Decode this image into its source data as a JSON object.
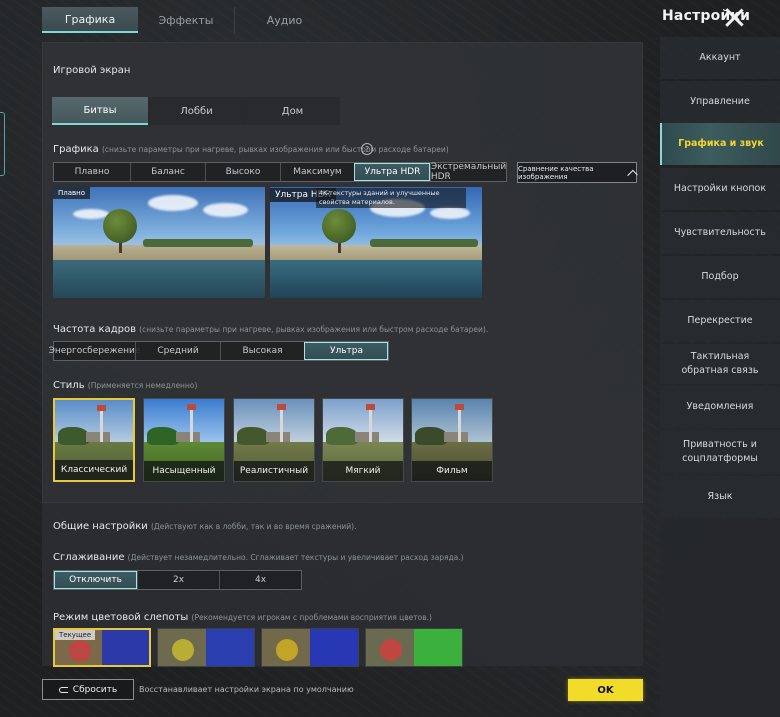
{
  "header": {
    "title": "Настройки",
    "tabs": [
      {
        "label": "Графика",
        "active": true
      },
      {
        "label": "Эффекты",
        "active": false
      },
      {
        "label": "Аудио",
        "active": false
      }
    ]
  },
  "screen": {
    "section_title": "Игровой экран",
    "mode_tabs": [
      {
        "label": "Битвы",
        "active": true
      },
      {
        "label": "Лобби",
        "active": false
      },
      {
        "label": "Дом",
        "active": false
      }
    ],
    "graphics": {
      "label": "Графика",
      "hint": "(снизьте параметры при нагреве, рывках изображения или быстром расходе батареи)",
      "help": "?",
      "options": [
        "Плавно",
        "Баланс",
        "Высоко",
        "Максимум",
        "Ультра HDR",
        "Экстремальный HDR"
      ],
      "selected": "Ультра HDR",
      "compare_label": "Сравнение качества изображения"
    },
    "previews": {
      "left_label": "Плавно",
      "right_label": "Ультра HDR",
      "right_desc": "4K-текстуры зданий и улучшенные свойства материалов."
    },
    "fps": {
      "label": "Частота кадров",
      "hint": "(снизьте параметры при нагреве, рывках изображения или быстром расходе батареи).",
      "options": [
        "Энергосбережение",
        "Средний",
        "Высокая",
        "Ультра"
      ],
      "selected": "Ультра"
    },
    "style": {
      "label": "Стиль",
      "hint": "(Применяется немедленно)",
      "options": [
        "Классический",
        "Насыщенный",
        "Реалистичный",
        "Мягкий",
        "Фильм"
      ],
      "selected": "Классический"
    }
  },
  "general": {
    "label": "Общие настройки",
    "hint": "(Действуют как в лобби, так и во время сражений).",
    "aa": {
      "label": "Сглаживание",
      "hint": "(Действует незамедлительно. Сглаживает текстуры и увеличивает расход заряда.)",
      "options": [
        "Отключить",
        "2x",
        "4x"
      ],
      "selected": "Отключить"
    },
    "colorblind": {
      "label": "Режим цветовой слепоты",
      "hint": "(Рекомендуется игрокам с проблемами восприятия цветов.)",
      "current_tag": "Текущее"
    }
  },
  "footer": {
    "reset_label": "Сбросить",
    "reset_desc": "Восстанавливает настройки экрана по умолчанию",
    "ok_label": "OK"
  },
  "sidebar": {
    "items": [
      {
        "label": "Аккаунт",
        "active": false
      },
      {
        "label": "Управление",
        "active": false
      },
      {
        "label": "Графика и звук",
        "active": true
      },
      {
        "label": "Настройки кнопок",
        "active": false
      },
      {
        "label": "Чувствительность",
        "active": false
      },
      {
        "label": "Подбор",
        "active": false
      },
      {
        "label": "Перекрестие",
        "active": false
      },
      {
        "label": "Тактильная обратная связь",
        "active": false
      },
      {
        "label": "Уведомления",
        "active": false
      },
      {
        "label": "Приватность и соцплатформы",
        "active": false
      },
      {
        "label": "Язык",
        "active": false
      }
    ]
  },
  "colors": {
    "accent": "#7fd8d6",
    "highlight": "#f2dc2a",
    "panel": "#303235"
  }
}
